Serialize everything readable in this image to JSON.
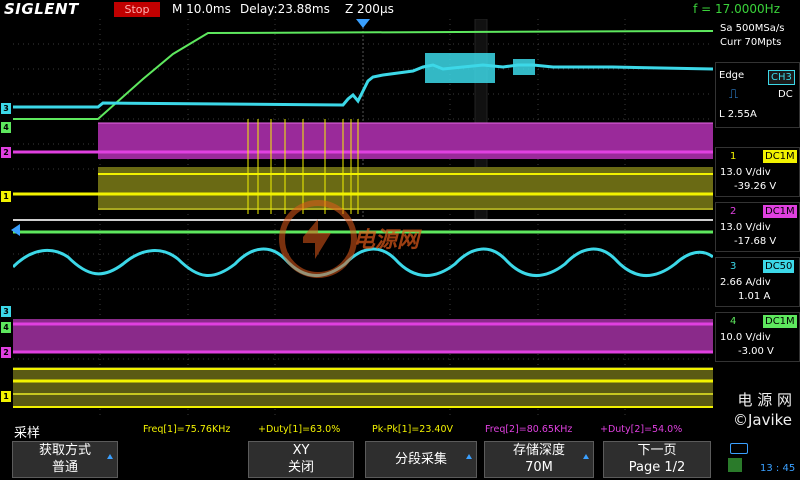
{
  "header": {
    "brand": "SIGLENT",
    "run_state": "Stop",
    "timebase": "M 10.0ms",
    "delay": "Delay:23.88ms",
    "zoom": "Z 200µs",
    "frequency": "f = 17.0000Hz"
  },
  "acquisition": {
    "sample_rate": "Sa 500MSa/s",
    "memory": "Curr 70Mpts"
  },
  "trigger": {
    "type": "Edge",
    "source": "CH3",
    "slope_icon": "rising-edge-icon",
    "coupling": "DC",
    "level": "L  2.55A"
  },
  "channels": [
    {
      "num": "1",
      "coupling": "DC1M",
      "scale": "13.0 V/div",
      "offset": "-39.26 V",
      "color": "#f2f200"
    },
    {
      "num": "2",
      "coupling": "DC1M",
      "scale": "13.0 V/div",
      "offset": "-17.68 V",
      "color": "#e040e0"
    },
    {
      "num": "3",
      "coupling": "DC50",
      "scale": "2.66 A/div",
      "offset": "1.01 A",
      "color": "#3cd8e8"
    },
    {
      "num": "4",
      "coupling": "DC1M",
      "scale": "10.0 V/div",
      "offset": "-3.00 V",
      "color": "#3ae83a"
    }
  ],
  "measurements": [
    {
      "label": "Freq[1]=75.76KHz",
      "color": "#f2f200"
    },
    {
      "label": "+Duty[1]=63.0%",
      "color": "#f2f200"
    },
    {
      "label": "Pk-Pk[1]=23.40V",
      "color": "#f2f200"
    },
    {
      "label": "Freq[2]=80.65KHz",
      "color": "#e040e0"
    },
    {
      "label": "+Duty[2]=54.0%",
      "color": "#e040e0"
    }
  ],
  "mode_label": "采样",
  "softkeys": [
    {
      "line1": "获取方式",
      "line2": "普通"
    },
    {
      "line1": "XY",
      "line2": "关闭"
    },
    {
      "line1": "分段采集",
      "line2": ""
    },
    {
      "line1": "存储深度",
      "line2": "70M"
    },
    {
      "line1": "下一页",
      "line2": "Page 1/2"
    }
  ],
  "watermark": {
    "center": "电源网",
    "corner_line1": "电 源 网",
    "corner_line2": "©Javike"
  },
  "status": {
    "clock": "13 : 45"
  }
}
